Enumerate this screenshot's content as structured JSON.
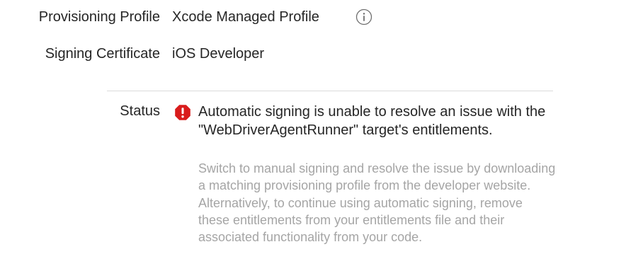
{
  "signing": {
    "provisioning_profile": {
      "label": "Provisioning Profile",
      "value": "Xcode Managed Profile",
      "icon": "info-icon"
    },
    "signing_certificate": {
      "label": "Signing Certificate",
      "value": "iOS Developer"
    },
    "status": {
      "label": "Status",
      "icon": "error-icon",
      "icon_color": "#d91c1c",
      "title": "Automatic signing is unable to resolve an issue with the \"WebDriverAgentRunner\" target's entitlements.",
      "detail": "Switch to manual signing and resolve the issue by downloading a matching provisioning profile from the developer website. Alternatively, to continue using automatic signing, remove these entitlements from your entitlements file and their associated functionality from your code."
    }
  }
}
